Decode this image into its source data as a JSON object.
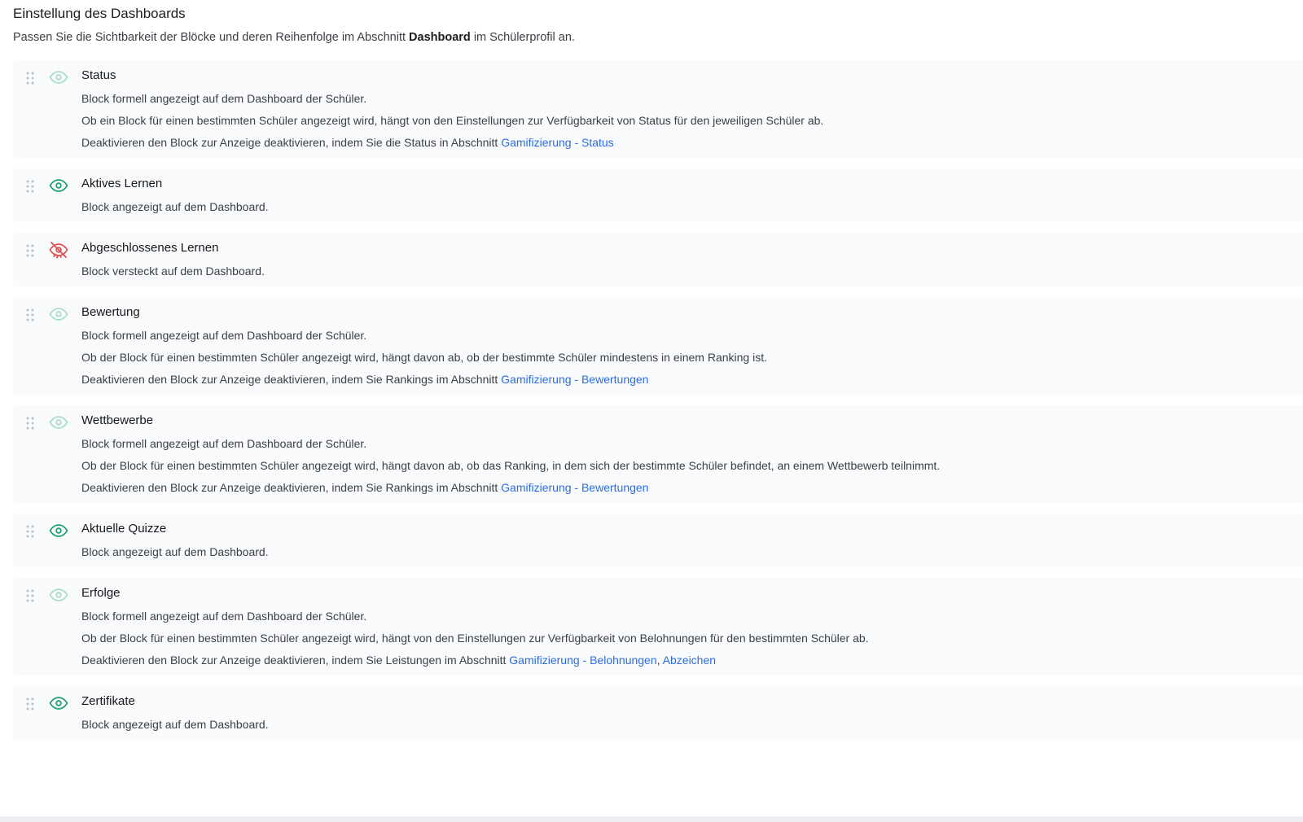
{
  "header": {
    "title": "Einstellung des Dashboards",
    "desc_before": "Passen Sie die Sichtbarkeit der Blöcke und deren Reihenfolge im Abschnitt ",
    "desc_strong": "Dashboard",
    "desc_after": " im Schülerprofil an."
  },
  "colors": {
    "visible": "#1f9e6e",
    "formal": "#a8dcc8",
    "hidden": "#e05252",
    "link": "#2b6de0"
  },
  "blocks": [
    {
      "title": "Status",
      "state": "formal",
      "icon": "eye-icon",
      "line1": "Block formell angezeigt auf dem Dashboard der Schüler.",
      "line2": "Ob ein Block für einen bestimmten Schüler angezeigt wird, hängt von den Einstellungen zur Verfügbarkeit von Status für den jeweiligen Schüler ab.",
      "line3_text": "Deaktivieren den Block zur Anzeige deaktivieren, indem Sie die Status in Abschnitt ",
      "link1": "Gamifizierung - Status"
    },
    {
      "title": "Aktives Lernen",
      "state": "visible",
      "icon": "eye-icon",
      "line1": "Block angezeigt auf dem Dashboard."
    },
    {
      "title": "Abgeschlossenes Lernen",
      "state": "hidden",
      "icon": "eye-off-icon",
      "line1": "Block versteckt auf dem Dashboard."
    },
    {
      "title": "Bewertung",
      "state": "formal",
      "icon": "eye-icon",
      "line1": "Block formell angezeigt auf dem Dashboard der Schüler.",
      "line2": "Ob der Block für einen bestimmten Schüler angezeigt wird, hängt davon ab, ob der bestimmte Schüler mindestens in einem Ranking ist.",
      "line3_text": "Deaktivieren den Block zur Anzeige deaktivieren, indem Sie Rankings im Abschnitt ",
      "link1": "Gamifizierung - Bewertungen"
    },
    {
      "title": "Wettbewerbe",
      "state": "formal",
      "icon": "eye-icon",
      "line1": "Block formell angezeigt auf dem Dashboard der Schüler.",
      "line2": "Ob der Block für einen bestimmten Schüler angezeigt wird, hängt davon ab, ob das Ranking, in dem sich der bestimmte Schüler befindet, an einem Wettbewerb teilnimmt.",
      "line3_text": "Deaktivieren den Block zur Anzeige deaktivieren, indem Sie Rankings im Abschnitt ",
      "link1": "Gamifizierung - Bewertungen"
    },
    {
      "title": "Aktuelle Quizze",
      "state": "visible",
      "icon": "eye-icon",
      "line1": "Block angezeigt auf dem Dashboard."
    },
    {
      "title": "Erfolge",
      "state": "formal",
      "icon": "eye-icon",
      "line1": "Block formell angezeigt auf dem Dashboard der Schüler.",
      "line2": "Ob der Block für einen bestimmten Schüler angezeigt wird, hängt von den Einstellungen zur Verfügbarkeit von Belohnungen für den bestimmten Schüler ab.",
      "line3_text": "Deaktivieren den Block zur Anzeige deaktivieren, indem Sie Leistungen im Abschnitt ",
      "link1": "Gamifizierung - Belohnungen",
      "separator": ", ",
      "link2": "Abzeichen"
    },
    {
      "title": "Zertifikate",
      "state": "visible",
      "icon": "eye-icon",
      "line1": "Block angezeigt auf dem Dashboard."
    }
  ]
}
